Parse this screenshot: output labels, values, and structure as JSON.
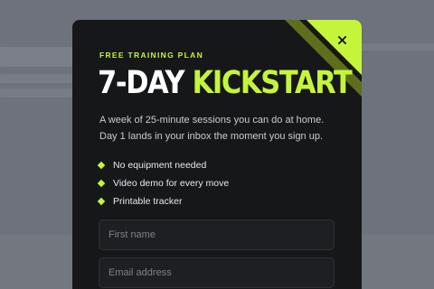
{
  "colors": {
    "accent": "#c5f53b",
    "modal_bg": "#161719",
    "backdrop": "#6e727c",
    "field_bg": "#1e1f22"
  },
  "modal": {
    "eyebrow": "FREE TRAINING PLAN",
    "headline_part1": "7-DAY",
    "headline_part2": "KICKSTART",
    "description": "A week of 25-minute sessions you can do at home. Day 1 lands in your inbox the moment you sign up.",
    "close_icon": "close-icon",
    "benefit_icon": "diamond-icon",
    "benefits": [
      "No equipment needed",
      "Video demo for every move",
      "Printable tracker"
    ],
    "form": {
      "first_name_placeholder": "First name",
      "email_placeholder": "Email address"
    }
  }
}
